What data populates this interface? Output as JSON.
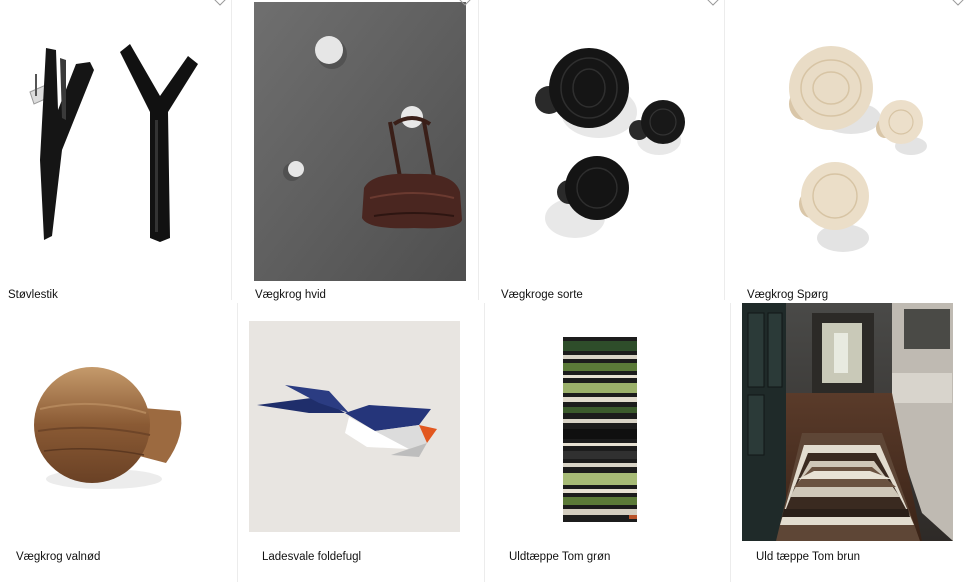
{
  "products": [
    {
      "name": "Støvlestik",
      "image": "black-branch-boot-hooks",
      "favorite_icon": "heart-outline-icon"
    },
    {
      "name": "Vægkrog hvid",
      "image": "white-wall-hooks-grey-wall",
      "favorite_icon": "heart-outline-icon"
    },
    {
      "name": "Vægkroge sorte",
      "image": "black-round-wall-hooks",
      "favorite_icon": "heart-outline-icon"
    },
    {
      "name": "Vægkrog Spørg",
      "image": "ash-wood-round-wall-hooks",
      "favorite_icon": "heart-outline-icon"
    },
    {
      "name": "Vægkrog valnød",
      "image": "walnut-wall-hook",
      "favorite_icon": "heart-outline-icon"
    },
    {
      "name": "Ladesvale foldefugl",
      "image": "folded-paper-swallow",
      "favorite_icon": "heart-outline-icon"
    },
    {
      "name": "Uldtæppe Tom grøn",
      "image": "green-striped-wool-rug",
      "favorite_icon": "heart-outline-icon"
    },
    {
      "name": "Uld tæppe Tom brun",
      "image": "brown-striped-runner-hallway",
      "favorite_icon": "heart-outline-icon"
    }
  ],
  "colors": {
    "background": "#ffffff",
    "text": "#111111",
    "divider": "#ececec"
  }
}
